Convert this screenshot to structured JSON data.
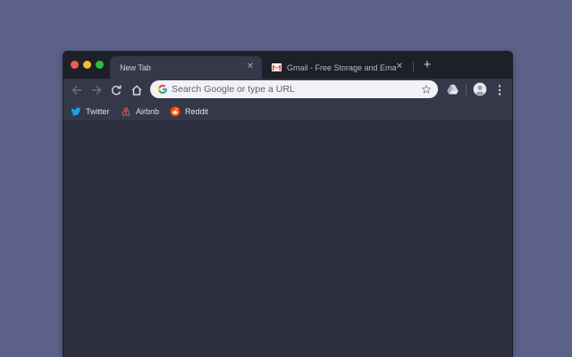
{
  "colors": {
    "desktop_bg": "#5b6188",
    "tabstrip_bg": "#1e2029",
    "toolbar_bg": "#343848",
    "content_bg": "#2b2e3d",
    "omnibox_bg": "#f1f2f5"
  },
  "tabs": [
    {
      "title": "New Tab",
      "active": true,
      "icon": "none"
    },
    {
      "title": "Gmail - Free Storage and Email",
      "active": false,
      "icon": "gmail-icon"
    }
  ],
  "omnibox": {
    "placeholder": "Search Google or type a URL",
    "value": ""
  },
  "bookmarks": [
    {
      "label": "Twitter",
      "icon": "twitter-icon"
    },
    {
      "label": "Airbnb",
      "icon": "airbnb-icon"
    },
    {
      "label": "Reddit",
      "icon": "reddit-icon"
    }
  ]
}
